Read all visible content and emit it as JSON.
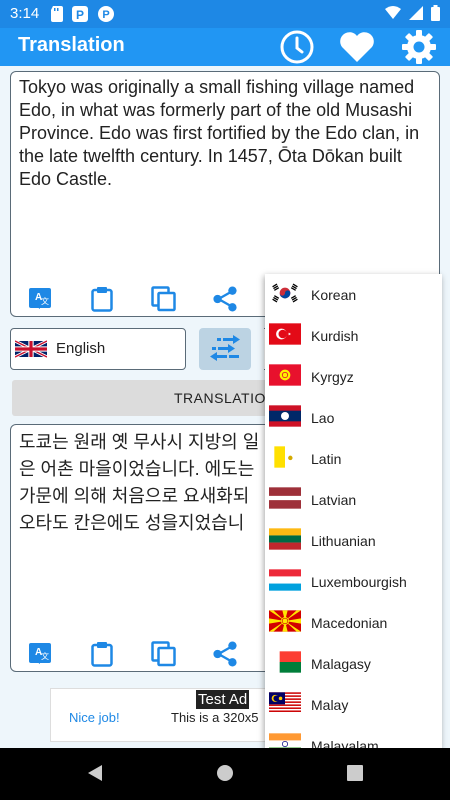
{
  "status": {
    "time": "3:14"
  },
  "appbar": {
    "title": "Translation",
    "icons": [
      "clock-icon",
      "heart-icon",
      "settings-icon"
    ]
  },
  "source": {
    "text": "Tokyo was originally a small fishing village named Edo, in what was formerly part of the old Musashi Province. Edo was first fortified by the Edo clan, in the late twelfth century. In 1457, Ōta Dōkan built Edo Castle."
  },
  "languages": {
    "from": "English"
  },
  "translate_button": {
    "label": "TRANSLATIO"
  },
  "result": {
    "lines": [
      "도쿄는 원래 옛 무사시 지방의 일",
      "은 어촌 마을이었습니다. 에도는",
      "가문에 의해 처음으로 요새화되",
      "오타도 칸은에도 성을지었습니"
    ]
  },
  "ad": {
    "nice": "Nice job!",
    "text": "This is a 320x5",
    "badge": "Test Ad"
  },
  "dropdown": {
    "items": [
      {
        "name": "Korean",
        "flag": "kr"
      },
      {
        "name": "Kurdish",
        "flag": "tr"
      },
      {
        "name": "Kyrgyz",
        "flag": "kg"
      },
      {
        "name": "Lao",
        "flag": "la"
      },
      {
        "name": "Latin",
        "flag": "va"
      },
      {
        "name": "Latvian",
        "flag": "lv"
      },
      {
        "name": "Lithuanian",
        "flag": "lt"
      },
      {
        "name": "Luxembourgish",
        "flag": "lu"
      },
      {
        "name": "Macedonian",
        "flag": "mk"
      },
      {
        "name": "Malagasy",
        "flag": "mg"
      },
      {
        "name": "Malay",
        "flag": "my"
      },
      {
        "name": "Malayalam",
        "flag": "in"
      }
    ]
  },
  "colors": {
    "primary": "#2196f3",
    "status": "#1e88e5",
    "swap_bg": "#bcd3e3"
  }
}
